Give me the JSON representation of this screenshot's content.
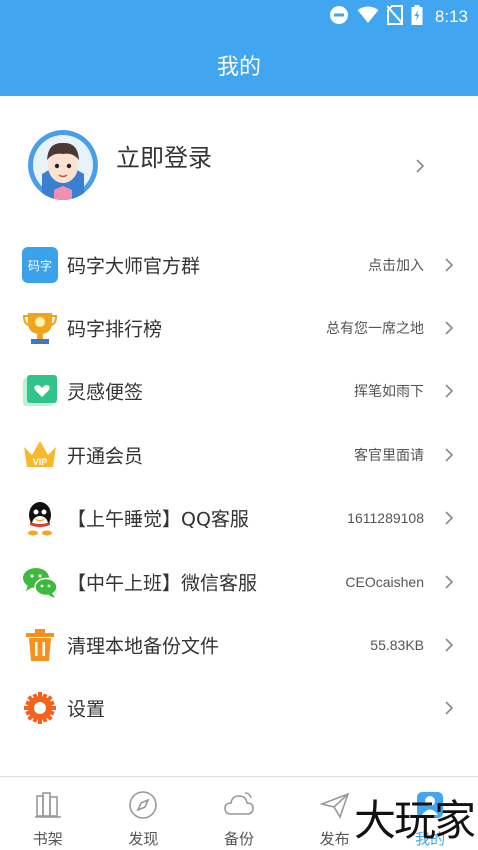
{
  "status_bar": {
    "time": "8:13"
  },
  "header": {
    "title": "我的"
  },
  "profile": {
    "login_label": "立即登录"
  },
  "menu": [
    {
      "icon": "maxzi-badge-icon",
      "label": "码字大师官方群",
      "value": "点击加入"
    },
    {
      "icon": "trophy-icon",
      "label": "码字排行榜",
      "value": "总有您一席之地"
    },
    {
      "icon": "sticky-note-heart-icon",
      "label": "灵感便签",
      "value": "挥笔如雨下"
    },
    {
      "icon": "vip-crown-icon",
      "label": "开通会员",
      "value": "客官里面请"
    },
    {
      "icon": "qq-penguin-icon",
      "label": "【上午睡觉】QQ客服",
      "value": "1611289108"
    },
    {
      "icon": "wechat-icon",
      "label": "【中午上班】微信客服",
      "value": "CEOcaishen"
    },
    {
      "icon": "trash-icon",
      "label": "清理本地备份文件",
      "value": "55.83KB"
    },
    {
      "icon": "gear-icon",
      "label": "设置",
      "value": ""
    }
  ],
  "bottom_nav": [
    {
      "icon": "bookshelf-icon",
      "label": "书架"
    },
    {
      "icon": "compass-icon",
      "label": "发现"
    },
    {
      "icon": "cloud-icon",
      "label": "备份"
    },
    {
      "icon": "send-icon",
      "label": "发布"
    },
    {
      "icon": "person-icon",
      "label": "我的",
      "active": true
    }
  ],
  "watermark": "大玩家",
  "colors": {
    "primary": "#42a5f0",
    "text": "#333333",
    "subtext": "#555555"
  }
}
